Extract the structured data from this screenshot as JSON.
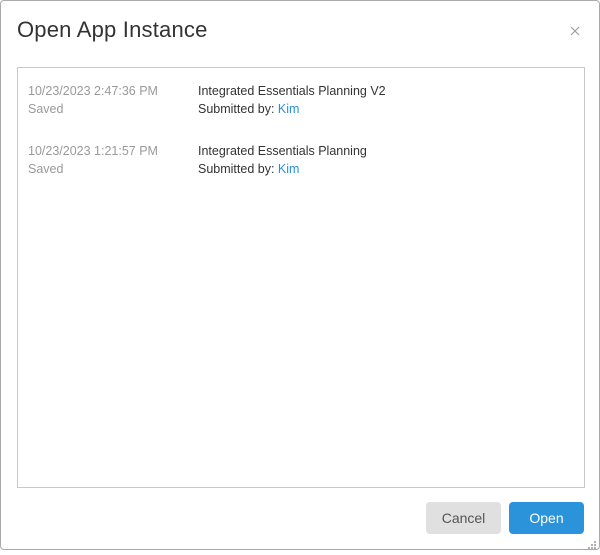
{
  "dialog": {
    "title": "Open App Instance",
    "close_icon": "close-icon"
  },
  "instances": [
    {
      "timestamp": "10/23/2023 2:47:36 PM",
      "status": "Saved",
      "name": "Integrated Essentials Planning V2",
      "submitted_label": "Submitted by:",
      "submitted_by": "Kim"
    },
    {
      "timestamp": "10/23/2023 1:21:57 PM",
      "status": "Saved",
      "name": "Integrated Essentials Planning",
      "submitted_label": "Submitted by:",
      "submitted_by": "Kim"
    }
  ],
  "buttons": {
    "cancel_label": "Cancel",
    "open_label": "Open"
  },
  "colors": {
    "accent": "#2b93d9",
    "link": "#2b8fd6",
    "muted_text": "#9a9a9a"
  }
}
